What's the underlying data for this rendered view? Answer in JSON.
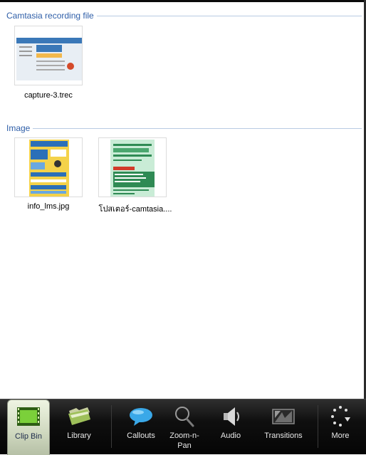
{
  "sections": [
    {
      "title": "Camtasia recording file",
      "items": [
        {
          "label": "capture-3.trec"
        }
      ]
    },
    {
      "title": "Image",
      "items": [
        {
          "label": "info_lms.jpg"
        },
        {
          "label": "โปสเตอร์-camtasia...."
        }
      ]
    }
  ],
  "toolbar": {
    "items": [
      {
        "label": "Clip Bin",
        "icon": "film-icon",
        "active": true
      },
      {
        "label": "Library",
        "icon": "folder-icon",
        "active": false
      },
      {
        "label": "Callouts",
        "icon": "speech-bubble-icon",
        "active": false
      },
      {
        "label": "Zoom-n-Pan",
        "icon": "magnifier-icon",
        "active": false
      },
      {
        "label": "Audio",
        "icon": "speaker-icon",
        "active": false
      },
      {
        "label": "Transitions",
        "icon": "transitions-icon",
        "active": false
      },
      {
        "label": "More",
        "icon": "more-dots-icon",
        "active": false
      }
    ]
  }
}
